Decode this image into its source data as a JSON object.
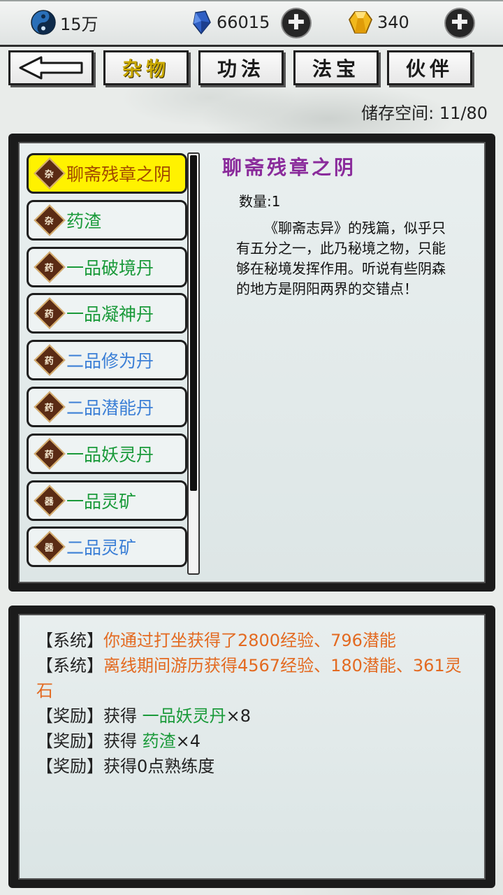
{
  "resources": {
    "cultivation": "15万",
    "crystal": "66015",
    "gold": "340"
  },
  "tabs": [
    {
      "label": "杂物",
      "active": true
    },
    {
      "label": "功法",
      "active": false
    },
    {
      "label": "法宝",
      "active": false
    },
    {
      "label": "伙伴",
      "active": false
    }
  ],
  "storage_text": "储存空间: 11/80",
  "items": [
    {
      "badge": "杂",
      "name": "聊斋残章之阴",
      "color": "#a24a00",
      "selected": true
    },
    {
      "badge": "杂",
      "name": "药渣",
      "color": "#1a9a3a"
    },
    {
      "badge": "药",
      "name": "一品破境丹",
      "color": "#1a9a3a"
    },
    {
      "badge": "药",
      "name": "一品凝神丹",
      "color": "#1a9a3a"
    },
    {
      "badge": "药",
      "name": "二品修为丹",
      "color": "#3b7fd6"
    },
    {
      "badge": "药",
      "name": "二品潜能丹",
      "color": "#3b7fd6"
    },
    {
      "badge": "药",
      "name": "一品妖灵丹",
      "color": "#1a9a3a"
    },
    {
      "badge": "器",
      "name": "一品灵矿",
      "color": "#1a9a3a"
    },
    {
      "badge": "器",
      "name": "二品灵矿",
      "color": "#3b7fd6"
    }
  ],
  "detail": {
    "title": "聊斋残章之阴",
    "quantity": "数量:1",
    "description": "《聊斋志异》的残篇，似乎只有五分之一，此乃秘境之物，只能够在秘境发挥作用。听说有些阴森的地方是阴阳两界的交错点！"
  },
  "log": [
    {
      "tag": "【系统】",
      "text": "你通过打坐获得了2800经验、796潜能",
      "text_color": "orange"
    },
    {
      "tag": "【系统】",
      "text": "离线期间游历获得4567经验、180潜能、361灵石",
      "text_color": "orange"
    },
    {
      "tag": "【奖励】",
      "prefix": "获得 ",
      "item": "一品妖灵丹",
      "suffix": "×8"
    },
    {
      "tag": "【奖励】",
      "prefix": "获得 ",
      "item": "药渣",
      "suffix": "×4"
    },
    {
      "tag": "【奖励】",
      "text": "获得0点熟练度",
      "text_color": "plain"
    }
  ]
}
